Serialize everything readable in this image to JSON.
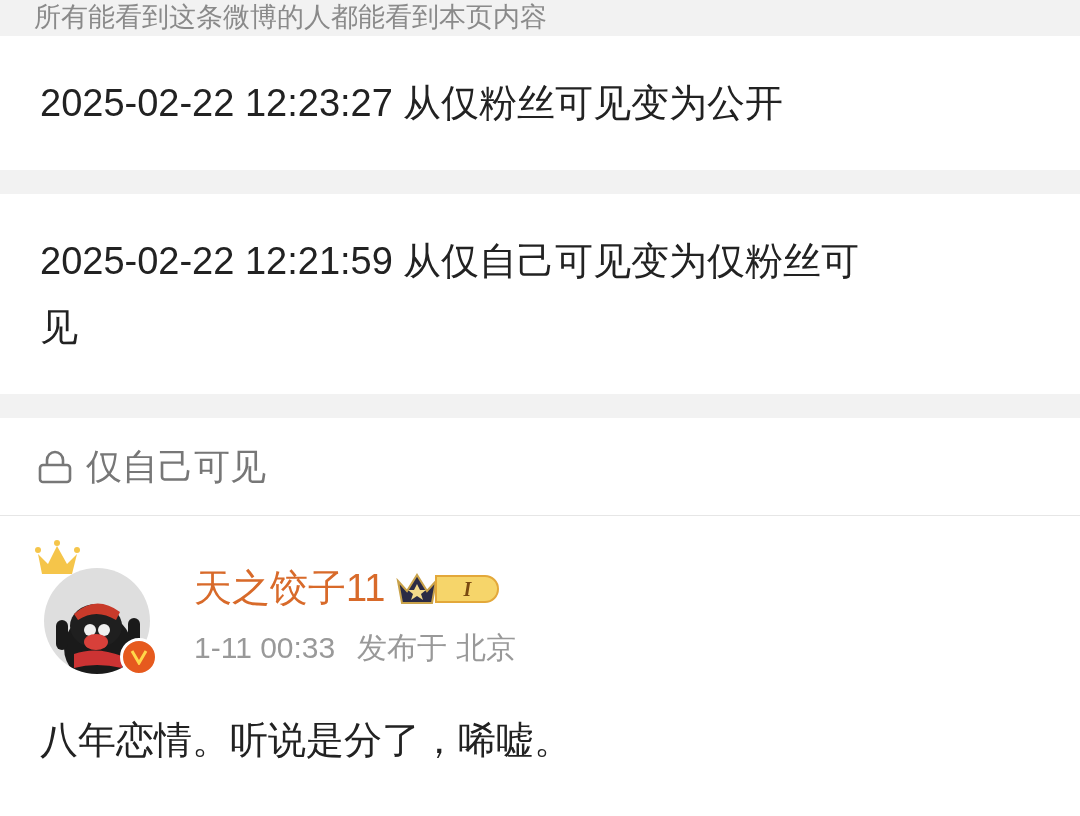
{
  "visibility_note": "所有能看到这条微博的人都能看到本页内容",
  "history": [
    {
      "text": "2025-02-22 12:23:27 从仅粉丝可见变为公开"
    },
    {
      "text": "2025-02-22 12:21:59 从仅自己可见变为仅粉丝可见"
    }
  ],
  "current_visibility": {
    "label": "仅自己可见"
  },
  "post": {
    "author": "天之饺子11",
    "verified": true,
    "level": "I",
    "time": "1-11 00:33",
    "location": "发布于 北京",
    "text": "八年恋情。听说是分了，唏嘘。"
  }
}
